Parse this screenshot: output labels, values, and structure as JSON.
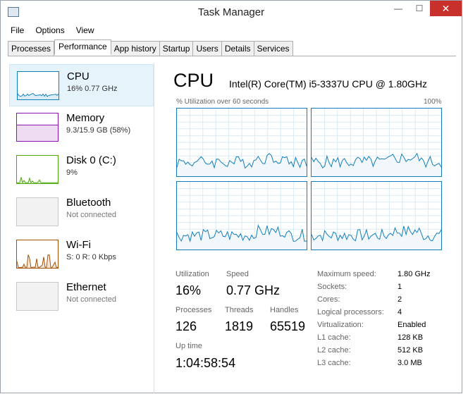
{
  "window": {
    "title": "Task Manager",
    "close_glyph": "✕",
    "max_glyph": "☐",
    "min_glyph": "—"
  },
  "menu": [
    "File",
    "Options",
    "View"
  ],
  "tabs": [
    "Processes",
    "Performance",
    "App history",
    "Startup",
    "Users",
    "Details",
    "Services"
  ],
  "active_tab": "Performance",
  "sidebar": [
    {
      "name": "CPU",
      "sub": "16% 0.77 GHz",
      "color": "#117dbb",
      "level": 0.16
    },
    {
      "name": "Memory",
      "sub": "9.3/15.9 GB (58%)",
      "color": "#8b12ae",
      "level": 0.58
    },
    {
      "name": "Disk 0 (C:)",
      "sub": "9%",
      "color": "#4da60c",
      "level": 0.09
    },
    {
      "name": "Bluetooth",
      "sub": "Not connected",
      "color": "#a0a0a0",
      "level": 0
    },
    {
      "name": "Wi-Fi",
      "sub": "S: 0 R: 0 Kbps",
      "color": "#a74f01",
      "level": 0.2
    },
    {
      "name": "Ethernet",
      "sub": "Not connected",
      "color": "#a0a0a0",
      "level": 0
    }
  ],
  "main": {
    "title": "CPU",
    "model": "Intel(R) Core(TM) i5-3337U CPU @ 1.80GHz",
    "graph_label": "% Utilization over 60 seconds",
    "graph_max": "100%",
    "graph_color": "#117dbb",
    "stats": {
      "utilization_label": "Utilization",
      "utilization": "16%",
      "speed_label": "Speed",
      "speed": "0.77 GHz",
      "processes_label": "Processes",
      "processes": "126",
      "threads_label": "Threads",
      "threads": "1819",
      "handles_label": "Handles",
      "handles": "65519",
      "uptime_label": "Up time",
      "uptime": "1:04:58:54"
    },
    "details": [
      {
        "k": "Maximum speed:",
        "v": "1.80 GHz"
      },
      {
        "k": "Sockets:",
        "v": "1"
      },
      {
        "k": "Cores:",
        "v": "2"
      },
      {
        "k": "Logical processors:",
        "v": "4"
      },
      {
        "k": "Virtualization:",
        "v": "Enabled"
      },
      {
        "k": "L1 cache:",
        "v": "128 KB"
      },
      {
        "k": "L2 cache:",
        "v": "512 KB"
      },
      {
        "k": "L3 cache:",
        "v": "3.0 MB"
      }
    ]
  }
}
